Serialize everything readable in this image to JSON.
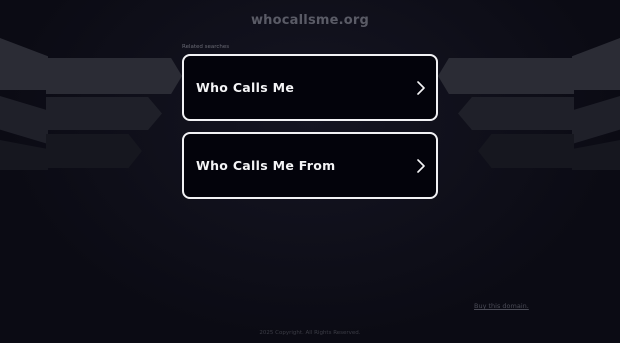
{
  "header": {
    "domain": "whocallsme.org"
  },
  "recent": {
    "label": "Related searches",
    "links": [
      {
        "label": "Who Calls Me"
      },
      {
        "label": "Who Calls Me From"
      }
    ]
  },
  "buy": {
    "label": "Buy this domain."
  },
  "footer": {
    "copyright": "2025 Copyright. All Rights Reserved."
  },
  "colors": {
    "background": "#0b0b14",
    "card_border": "#f2f2f5",
    "card_bg": "#03030b"
  },
  "icons": {
    "chevron": "chevron-right-icon"
  }
}
